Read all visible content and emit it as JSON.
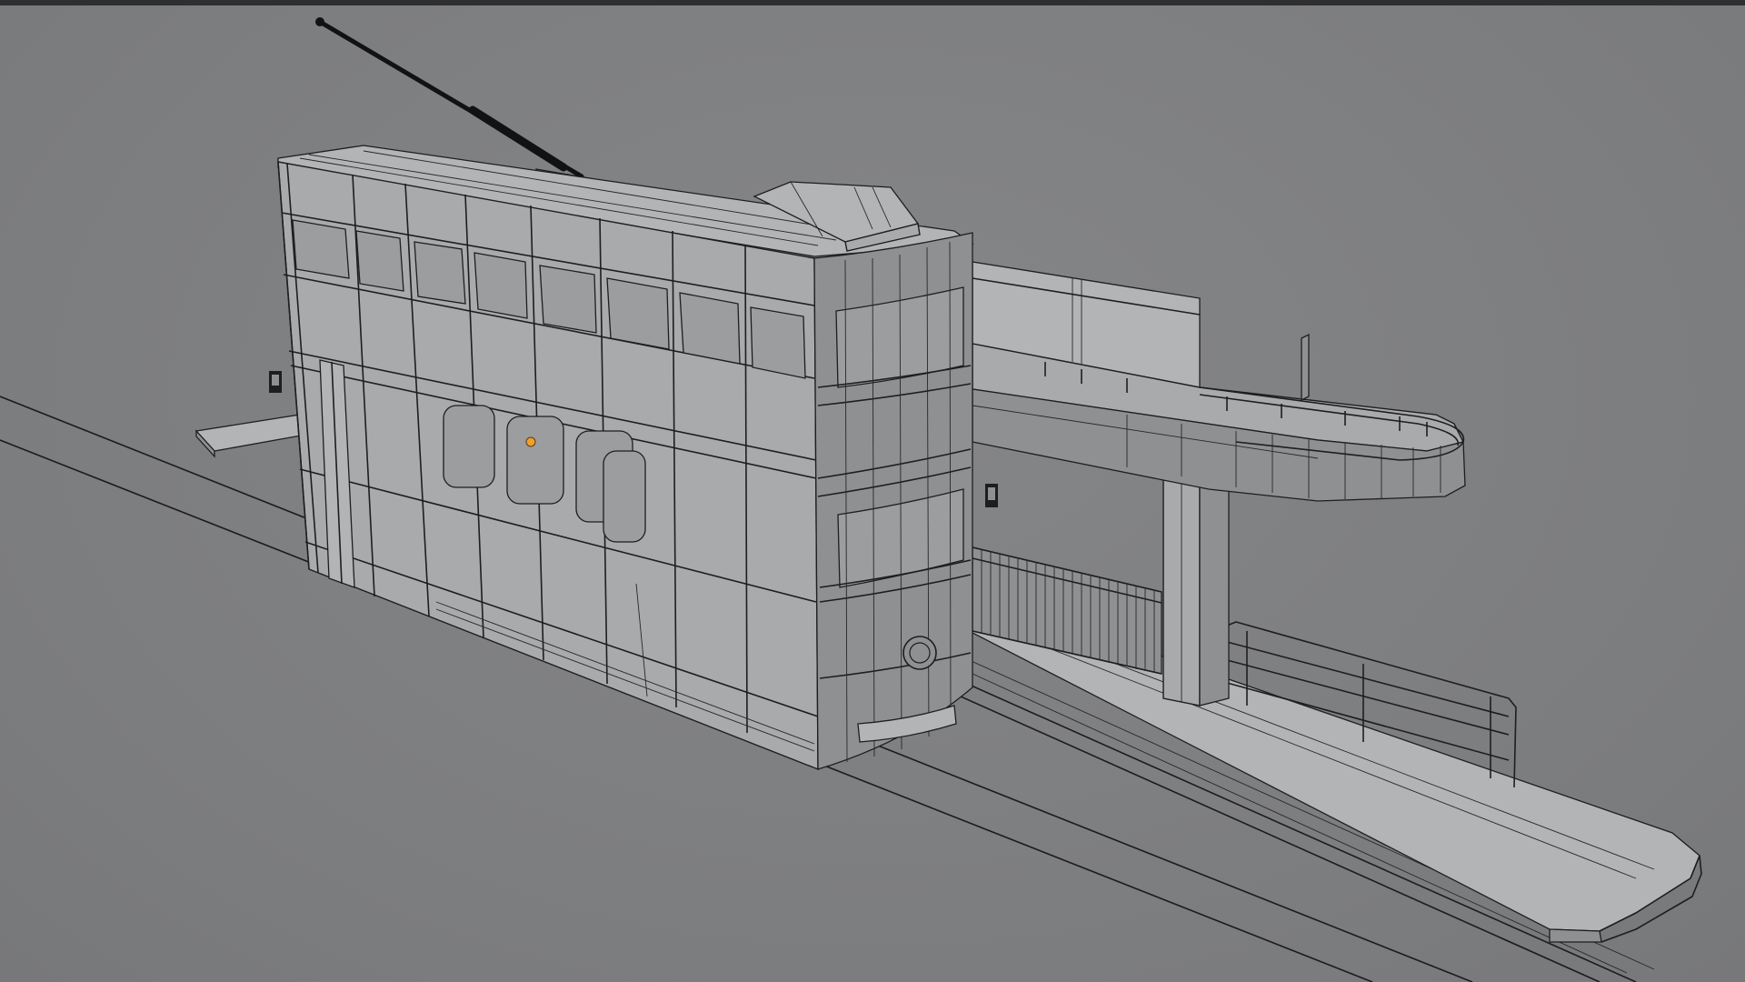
{
  "app": {
    "window_title": "",
    "mode": "3D viewport"
  },
  "viewport": {
    "display_mode": "wireframe-on-shaded",
    "background_color": "#7f8082",
    "wire_color": "#1d1e20",
    "surface_color": "#a9aaab",
    "selection_point_color": "#f0a030"
  },
  "scene": {
    "objects": [
      "double-decker-tram",
      "trolley-pole",
      "tram-tracks",
      "tram-stop-platform",
      "canopy-walkway",
      "canopy-support-column",
      "fence",
      "guard-railing"
    ]
  }
}
